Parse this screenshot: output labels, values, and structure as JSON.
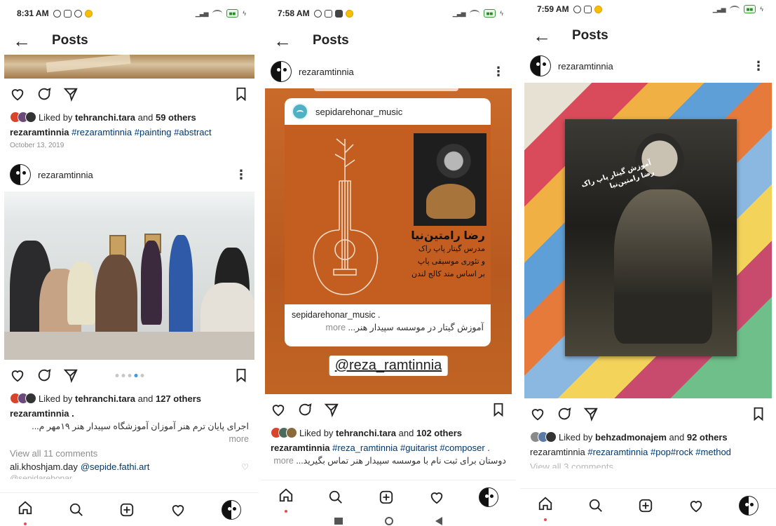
{
  "screens": [
    {
      "status_time": "8:31 AM",
      "header_title": "Posts",
      "post1": {
        "likes_user": "tehranchi.tara",
        "likes_others": "59 others",
        "caption_user": "rezaramtinnia",
        "hashtags": "#rezaramtinnia #painting #abstract",
        "date": "October 13, 2019"
      },
      "post2": {
        "username": "rezaramtinnia",
        "likes_user": "tehranchi.tara",
        "likes_others": "127 others",
        "caption_user": "rezaramtinnia .",
        "caption_fa": "اجرای پایان ترم هنر آموزان آموزشگاه سپیدار هنر ۱۹مهر م...",
        "more": "more",
        "comments_link": "View all 11 comments",
        "comment_user": "ali.khoshjam.day",
        "comment_mention": "@sepide.fathi.art",
        "faded": "@sepidarehonar"
      }
    },
    {
      "status_time": "7:58 AM",
      "header_title": "Posts",
      "username": "rezaramtinnia",
      "story": {
        "account": "sepidarehonar_music",
        "poster_name": "رضا رامتین‌نیا",
        "poster_line1": "مدرس گیتار پاپ راک",
        "poster_line2": "و تئوری موسیقی پاپ",
        "poster_line3": "بر اساس متد کالج لندن",
        "card_caption_user": "sepidarehonar_music .",
        "card_caption_fa": "آموزش گیتار در موسسه سپیدار هنر...",
        "more": "more",
        "handle": "@reza_ramtinnia"
      },
      "likes_user": "tehranchi.tara",
      "likes_others": "102 others",
      "caption_user": "rezaramtinnia",
      "hashtags": "#reza_ramtinnia #guitarist #composer .",
      "caption_fa": "دوستان برای ثبت نام با موسسه سپیدار هنر تماس بگیرید...",
      "more": "more"
    },
    {
      "status_time": "7:59 AM",
      "header_title": "Posts",
      "username": "rezaramtinnia",
      "photo_caption_1": "آموزش گیتار پاپ راک",
      "photo_caption_2": "رضا رامتین‌نیا",
      "likes_user": "behzadmonajem",
      "likes_others": "92 others",
      "caption_user": "rezaramtinnia",
      "hashtags": "#rezaramtinnia #pop#rock #method",
      "comments_link": "View all 3 comments"
    }
  ],
  "words": {
    "liked_by": "Liked by",
    "and": "and"
  },
  "colors": {
    "link_blue": "#00376b",
    "muted": "#8e8e8e",
    "active_dot": "#3897f0",
    "notify_red": "#ed4956",
    "poster_orange": "#c45e20"
  }
}
